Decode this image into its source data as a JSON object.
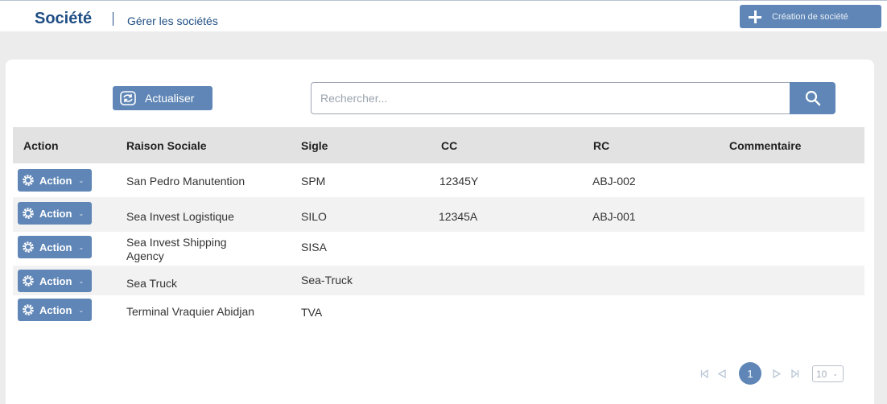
{
  "header": {
    "title": "Société",
    "subtitle": "Gérer les sociétés",
    "create_label": "Création de société"
  },
  "toolbar": {
    "refresh_label": "Actualiser",
    "search_placeholder": "Rechercher..."
  },
  "table": {
    "columns": [
      "Action",
      "Raison Sociale",
      "Sigle",
      "CC",
      "RC",
      "Commentaire"
    ],
    "action_label": "Action",
    "rows": [
      {
        "raison_sociale": "San Pedro Manutention",
        "sigle": "SPM",
        "cc": "12345Y",
        "rc": "ABJ-002",
        "commentaire": ""
      },
      {
        "raison_sociale": "Sea Invest Logistique",
        "sigle": "SILO",
        "cc": "12345A",
        "rc": "ABJ-001",
        "commentaire": ""
      },
      {
        "raison_sociale": "Sea Invest Shipping Agency",
        "sigle": "SISA",
        "cc": "",
        "rc": "",
        "commentaire": ""
      },
      {
        "raison_sociale": "Sea Truck",
        "sigle": "Sea-Truck",
        "cc": "",
        "rc": "",
        "commentaire": ""
      },
      {
        "raison_sociale": "Terminal Vraquier Abidjan",
        "sigle": "TVA",
        "cc": "",
        "rc": "",
        "commentaire": ""
      }
    ]
  },
  "pagination": {
    "current_page": "1",
    "page_size": "10"
  },
  "icons": {
    "create": "plus-icon",
    "refresh": "refresh-icon",
    "search": "search-icon",
    "action": "gear-icon",
    "first": "first-page-icon",
    "prev": "previous-page-icon",
    "next": "next-page-icon",
    "last": "last-page-icon"
  },
  "colors": {
    "primary": "#5f86b6",
    "title": "#1f4e84",
    "header_bg": "#e2e2e2",
    "alt_row_bg": "#f2f2f2",
    "page_bg": "#ececec"
  }
}
